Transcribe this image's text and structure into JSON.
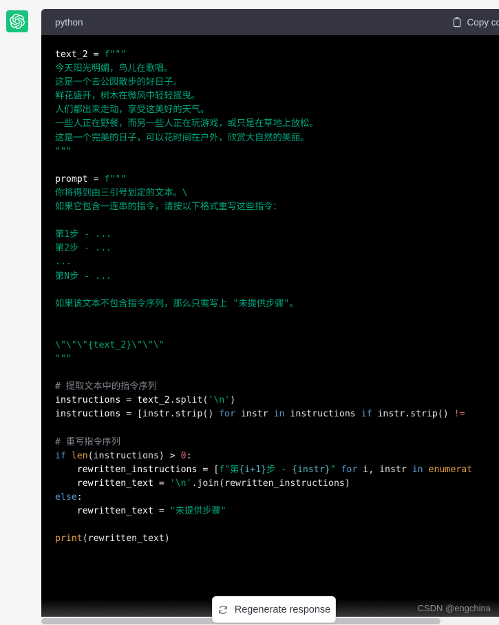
{
  "avatar": {
    "icon": "openai-logo-icon",
    "bg_color": "#19c37d"
  },
  "code_block": {
    "language_label": "python",
    "copy_label": "Copy code",
    "copy_icon": "clipboard-icon",
    "header_bg": "#343541",
    "body_bg": "#000000",
    "lines": [
      {
        "indent": 0,
        "tokens": [
          {
            "t": "text_2",
            "c": "t-def"
          },
          {
            "t": " = ",
            "c": "t-op"
          },
          {
            "t": "f\"\"\"",
            "c": "t-str"
          }
        ]
      },
      {
        "indent": 0,
        "tokens": [
          {
            "t": "今天阳光明媚，鸟儿在歌唱。",
            "c": "t-str"
          }
        ]
      },
      {
        "indent": 0,
        "tokens": [
          {
            "t": "这是一个去公园散步的好日子。",
            "c": "t-str"
          }
        ]
      },
      {
        "indent": 0,
        "tokens": [
          {
            "t": "鲜花盛开，树木在微风中轻轻摇曳。",
            "c": "t-str"
          }
        ]
      },
      {
        "indent": 0,
        "tokens": [
          {
            "t": "人们都出来走动，享受这美好的天气。",
            "c": "t-str"
          }
        ]
      },
      {
        "indent": 0,
        "tokens": [
          {
            "t": "一些人正在野餐，而另一些人正在玩游戏，或只是在草地上放松。",
            "c": "t-str"
          }
        ]
      },
      {
        "indent": 0,
        "tokens": [
          {
            "t": "这是一个完美的日子，可以花时间在户外，欣赏大自然的美丽。",
            "c": "t-str"
          }
        ]
      },
      {
        "indent": 0,
        "tokens": [
          {
            "t": "\"\"\"",
            "c": "t-str"
          }
        ]
      },
      {
        "indent": 0,
        "tokens": [
          {
            "t": "",
            "c": "t-op"
          }
        ]
      },
      {
        "indent": 0,
        "tokens": [
          {
            "t": "prompt",
            "c": "t-def"
          },
          {
            "t": " = ",
            "c": "t-op"
          },
          {
            "t": "f\"\"\"",
            "c": "t-str"
          }
        ]
      },
      {
        "indent": 0,
        "tokens": [
          {
            "t": "你将得到由三引号划定的文本。\\",
            "c": "t-str"
          }
        ]
      },
      {
        "indent": 0,
        "tokens": [
          {
            "t": "如果它包含一连串的指令，请按以下格式重写这些指令：",
            "c": "t-str"
          }
        ]
      },
      {
        "indent": 0,
        "tokens": [
          {
            "t": "",
            "c": "t-str"
          }
        ]
      },
      {
        "indent": 0,
        "tokens": [
          {
            "t": "第1步 - ...",
            "c": "t-str"
          }
        ]
      },
      {
        "indent": 0,
        "tokens": [
          {
            "t": "第2步 - ...",
            "c": "t-str"
          }
        ]
      },
      {
        "indent": 0,
        "tokens": [
          {
            "t": "...",
            "c": "t-str"
          }
        ]
      },
      {
        "indent": 0,
        "tokens": [
          {
            "t": "第N步 - ...",
            "c": "t-str"
          }
        ]
      },
      {
        "indent": 0,
        "tokens": [
          {
            "t": "",
            "c": "t-str"
          }
        ]
      },
      {
        "indent": 0,
        "tokens": [
          {
            "t": "如果该文本不包含指令序列，那么只需写上 \"未提供步骤\"。",
            "c": "t-str"
          }
        ]
      },
      {
        "indent": 0,
        "tokens": [
          {
            "t": "",
            "c": "t-str"
          }
        ]
      },
      {
        "indent": 0,
        "tokens": [
          {
            "t": "",
            "c": "t-str"
          }
        ]
      },
      {
        "indent": 0,
        "tokens": [
          {
            "t": "\\\"\\\"\\\"{text_2}\\\"\\\"\\\"",
            "c": "t-str"
          }
        ]
      },
      {
        "indent": 0,
        "tokens": [
          {
            "t": "\"\"\"",
            "c": "t-str"
          }
        ]
      },
      {
        "indent": 0,
        "tokens": [
          {
            "t": "",
            "c": "t-op"
          }
        ]
      },
      {
        "indent": 0,
        "tokens": [
          {
            "t": "# 提取文本中的指令序列",
            "c": "t-cmt"
          }
        ]
      },
      {
        "indent": 0,
        "tokens": [
          {
            "t": "instructions",
            "c": "t-def"
          },
          {
            "t": " = ",
            "c": "t-op"
          },
          {
            "t": "text_2",
            "c": "t-def"
          },
          {
            "t": ".split(",
            "c": "t-op"
          },
          {
            "t": "'\\n'",
            "c": "t-str"
          },
          {
            "t": ")",
            "c": "t-op"
          }
        ]
      },
      {
        "indent": 0,
        "tokens": [
          {
            "t": "instructions",
            "c": "t-def"
          },
          {
            "t": " = [instr.strip() ",
            "c": "t-op"
          },
          {
            "t": "for",
            "c": "t-kw"
          },
          {
            "t": " instr ",
            "c": "t-op"
          },
          {
            "t": "in",
            "c": "t-kw"
          },
          {
            "t": " instructions ",
            "c": "t-op"
          },
          {
            "t": "if",
            "c": "t-kw"
          },
          {
            "t": " instr.strip() ",
            "c": "t-op"
          },
          {
            "t": "!=",
            "c": "t-num"
          }
        ]
      },
      {
        "indent": 0,
        "tokens": [
          {
            "t": "",
            "c": "t-op"
          }
        ]
      },
      {
        "indent": 0,
        "tokens": [
          {
            "t": "# 重写指令序列",
            "c": "t-cmt"
          }
        ]
      },
      {
        "indent": 0,
        "tokens": [
          {
            "t": "if",
            "c": "t-kw"
          },
          {
            "t": " ",
            "c": "t-op"
          },
          {
            "t": "len",
            "c": "t-fn"
          },
          {
            "t": "(instructions) > ",
            "c": "t-op"
          },
          {
            "t": "0",
            "c": "t-num"
          },
          {
            "t": ":",
            "c": "t-op"
          }
        ]
      },
      {
        "indent": 1,
        "tokens": [
          {
            "t": "rewritten_instructions",
            "c": "t-def"
          },
          {
            "t": " = [",
            "c": "t-op"
          },
          {
            "t": "f\"第",
            "c": "t-str"
          },
          {
            "t": "{i+1}",
            "c": "t-fexp"
          },
          {
            "t": "步 - ",
            "c": "t-str"
          },
          {
            "t": "{instr}",
            "c": "t-fexp"
          },
          {
            "t": "\"",
            "c": "t-str"
          },
          {
            "t": " ",
            "c": "t-op"
          },
          {
            "t": "for",
            "c": "t-kw"
          },
          {
            "t": " i, instr ",
            "c": "t-op"
          },
          {
            "t": "in",
            "c": "t-kw"
          },
          {
            "t": " ",
            "c": "t-op"
          },
          {
            "t": "enumerat",
            "c": "t-fn"
          }
        ]
      },
      {
        "indent": 1,
        "tokens": [
          {
            "t": "rewritten_text",
            "c": "t-def"
          },
          {
            "t": " = ",
            "c": "t-op"
          },
          {
            "t": "'\\n'",
            "c": "t-str"
          },
          {
            "t": ".join(rewritten_instructions)",
            "c": "t-op"
          }
        ]
      },
      {
        "indent": 0,
        "tokens": [
          {
            "t": "else",
            "c": "t-kw"
          },
          {
            "t": ":",
            "c": "t-op"
          }
        ]
      },
      {
        "indent": 1,
        "tokens": [
          {
            "t": "rewritten_text",
            "c": "t-def"
          },
          {
            "t": " = ",
            "c": "t-op"
          },
          {
            "t": "\"未提供步骤\"",
            "c": "t-str"
          }
        ]
      },
      {
        "indent": 0,
        "tokens": [
          {
            "t": "",
            "c": "t-op"
          }
        ]
      },
      {
        "indent": 0,
        "tokens": [
          {
            "t": "print",
            "c": "t-fn"
          },
          {
            "t": "(rewritten_text)",
            "c": "t-op"
          }
        ]
      }
    ]
  },
  "regenerate_button": {
    "label": "Regenerate response",
    "icon": "refresh-icon"
  },
  "watermark": {
    "text": "CSDN @engchina"
  },
  "scrollbar": {
    "orientation": "horizontal"
  }
}
